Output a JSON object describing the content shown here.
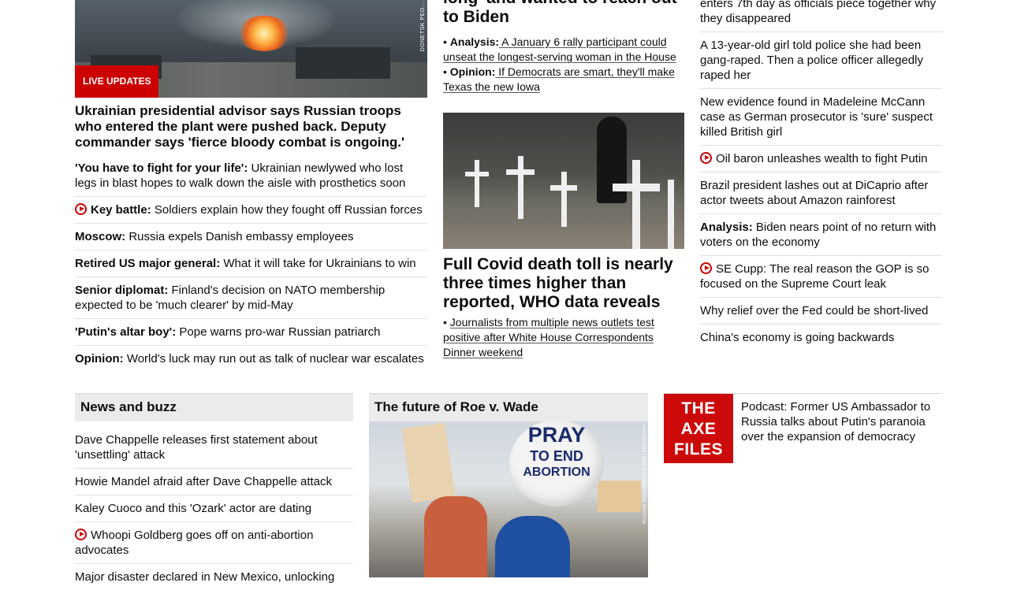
{
  "col1": {
    "hero_badge": "LIVE UPDATES",
    "hero_credit": "DONETSK PEO...",
    "hero_headline": "Ukrainian presidential advisor says Russian troops who entered the plant were pushed back. Deputy commander says 'fierce bloody combat is ongoing.'",
    "items": [
      {
        "label": "'You have to fight for your life':",
        "text": " Ukrainian newlywed who lost legs in blast hopes to walk down the aisle with prosthetics soon",
        "video": false
      },
      {
        "label": "Key battle:",
        "text": " Soldiers explain how they fought off Russian forces",
        "video": true
      },
      {
        "label": "Moscow:",
        "text": " Russia expels Danish embassy employees",
        "video": false
      },
      {
        "label": "Retired US major general:",
        "text": " What it will take for Ukrainians to win",
        "video": false
      },
      {
        "label": "Senior diplomat:",
        "text": " Finland's decision on NATO membership expected to be 'much clearer' by mid-May",
        "video": false
      },
      {
        "label": "'Putin's altar boy':",
        "text": " Pope warns pro-war Russian patriarch",
        "video": false
      },
      {
        "label": "Opinion:",
        "text": " World's luck may run out as talk of nuclear war escalates",
        "video": false
      }
    ]
  },
  "col2": {
    "top_headline": "long' and wanted to reach out to Biden",
    "top_bullets": [
      {
        "label": "Analysis:",
        "text": " A January 6 rally participant could unseat the longest-serving woman in the House"
      },
      {
        "label": "Opinion:",
        "text": " If Democrats are smart, they'll make Texas the new Iowa"
      }
    ],
    "covid_headline": "Full Covid death toll is nearly three times higher than reported, WHO data reveals",
    "covid_bullet": "Journalists from multiple news outlets test positive after White House Correspondents Dinner weekend"
  },
  "col3": {
    "items": [
      {
        "label": "",
        "text": "enters 7th day as officials piece together why they disappeared",
        "video": false
      },
      {
        "label": "",
        "text": "A 13-year-old girl told police she had been gang-raped. Then a police officer allegedly raped her",
        "video": false
      },
      {
        "label": "",
        "text": "New evidence found in Madeleine McCann case as German prosecutor is 'sure' suspect killed British girl",
        "video": false
      },
      {
        "label": "",
        "text": "Oil baron unleashes wealth to fight Putin",
        "video": true
      },
      {
        "label": "",
        "text": "Brazil president lashes out at DiCaprio after actor tweets about Amazon rainforest",
        "video": false
      },
      {
        "label": "Analysis:",
        "text": " Biden nears point of no return with voters on the economy",
        "video": false
      },
      {
        "label": "",
        "text": "SE Cupp: The real reason the GOP is so focused on the Supreme Court leak",
        "video": true
      },
      {
        "label": "",
        "text": "Why relief over the Fed could be short-lived",
        "video": false
      },
      {
        "label": "",
        "text": "China's economy is going backwards",
        "video": false
      }
    ]
  },
  "buzz": {
    "title": "News and buzz",
    "items": [
      {
        "text": "Dave Chappelle releases first statement about 'unsettling' attack",
        "video": false
      },
      {
        "text": "Howie Mandel afraid after Dave Chappelle attack",
        "video": false
      },
      {
        "text": "Kaley Cuoco and this 'Ozark' actor are dating",
        "video": false
      },
      {
        "text": "Whoopi Goldberg goes off on anti-abortion advocates",
        "video": true
      },
      {
        "text": "Major disaster declared in New Mexico, unlocking",
        "video": false
      }
    ]
  },
  "roe": {
    "title": "The future of Roe v. Wade",
    "balloon_line1": "PRAY",
    "balloon_line2": "TO END",
    "balloon_line3": "ABORTION",
    "credit": "ALLISON BAILEY/MIDDLE EAST IMAGES/AFP"
  },
  "axe": {
    "logo_line1": "THE",
    "logo_line2": "AXE",
    "logo_line3": "FILES",
    "podcast": "Podcast: Former US Ambassador to Russia talks about Putin's paranoia over the expansion of democracy"
  }
}
